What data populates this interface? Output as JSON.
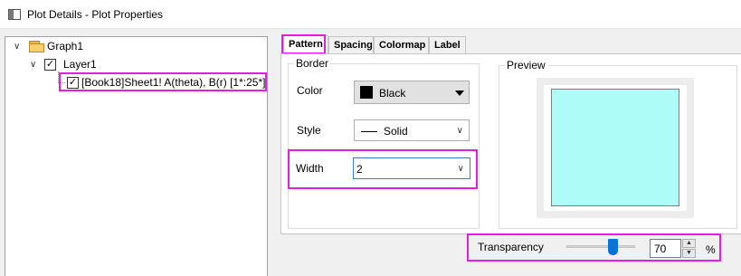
{
  "window": {
    "title": "Plot Details - Plot Properties"
  },
  "tree": {
    "graph": {
      "label": "Graph1"
    },
    "layer": {
      "label": "Layer1",
      "checked": true
    },
    "plot": {
      "label": "[Book18]Sheet1! A(theta), B(r) [1*:25*]",
      "checked": true
    }
  },
  "tabs": [
    {
      "label": "Pattern",
      "active": true
    },
    {
      "label": "Spacing",
      "active": false
    },
    {
      "label": "Colormap",
      "active": false
    },
    {
      "label": "Label",
      "active": false
    }
  ],
  "border": {
    "title": "Border",
    "color_label": "Color",
    "color_value": "Black",
    "color_hex": "#000000",
    "style_label": "Style",
    "style_value": "Solid",
    "width_label": "Width",
    "width_value": "2"
  },
  "preview": {
    "title": "Preview",
    "fill_color": "#aefcf8",
    "border_color": "#7f7f7f"
  },
  "transparency": {
    "label": "Transparency",
    "value": "70",
    "unit": "%"
  },
  "highlight_color": "#e020e0",
  "icons": {
    "app": "window-icon",
    "folder": "folder-icon",
    "expand": "chevron-down-icon",
    "dropdown": "dropdown-arrow-icon",
    "spin_up": "spin-up-icon",
    "spin_down": "spin-down-icon"
  }
}
